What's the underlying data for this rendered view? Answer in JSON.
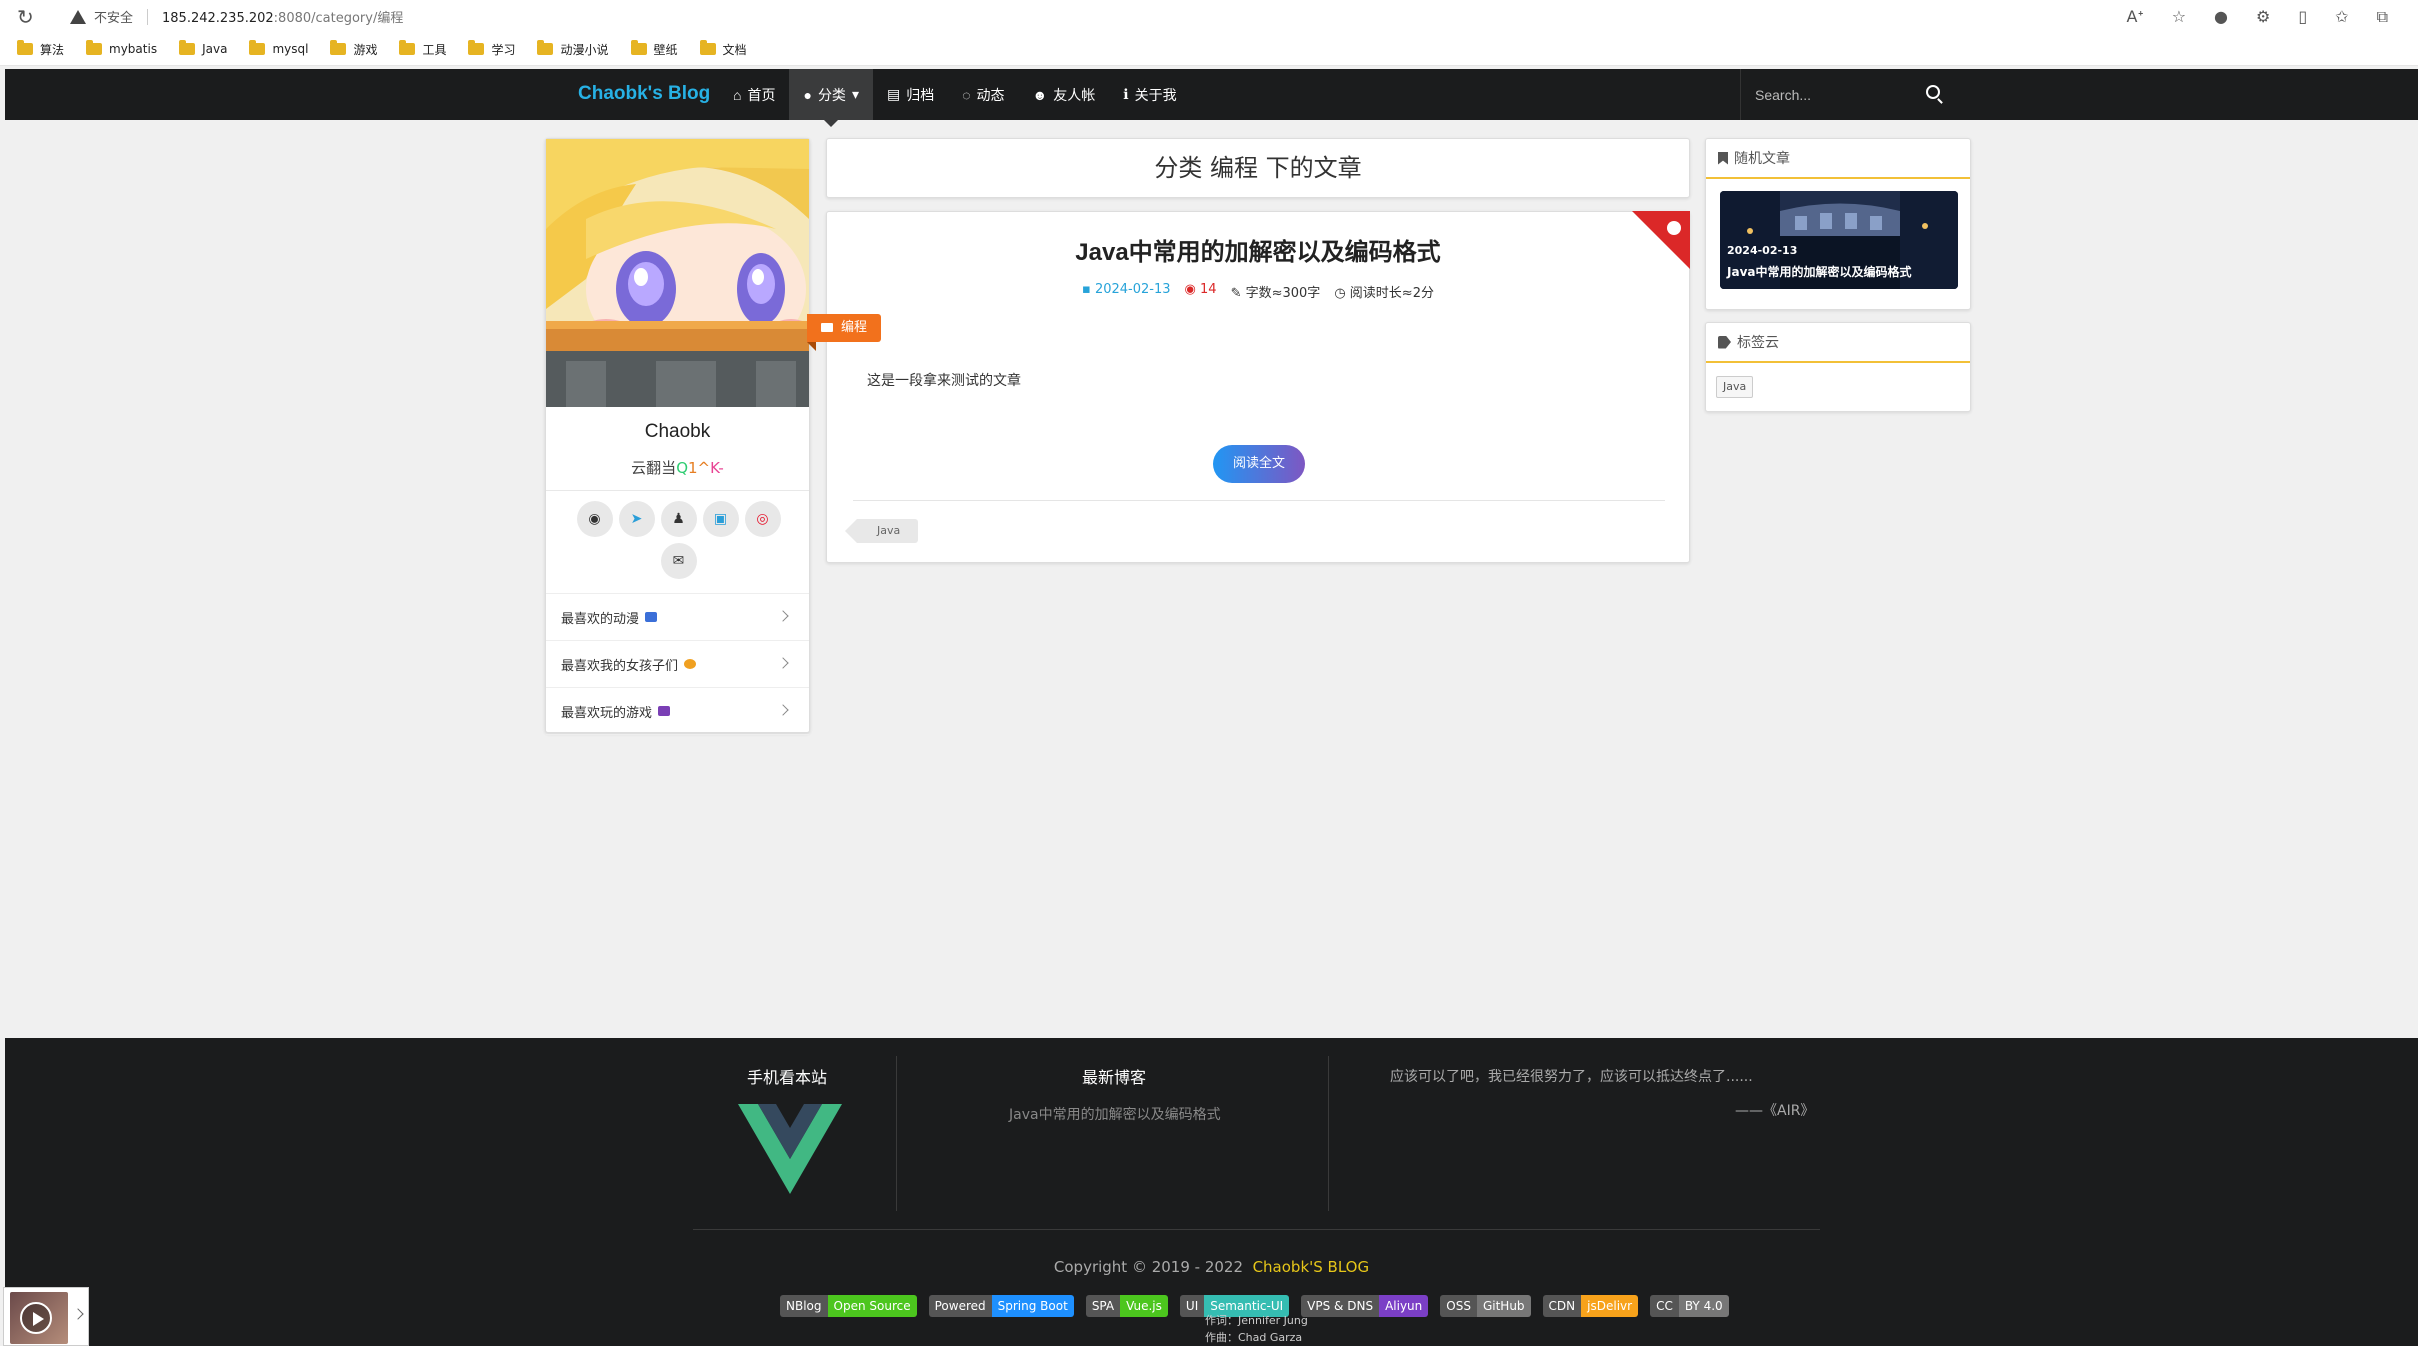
{
  "browser": {
    "security_label": "不安全",
    "url_host": "185.242.235.202",
    "url_path": ":8080/category/编程",
    "bookmarks": [
      "算法",
      "mybatis",
      "Java",
      "mysql",
      "游戏",
      "工具",
      "学习",
      "动漫小说",
      "壁纸",
      "文档"
    ]
  },
  "nav": {
    "brand": "Chaobk's Blog",
    "items": [
      {
        "label": "首页",
        "icon": "home-icon"
      },
      {
        "label": "分类",
        "icon": "lightbulb-icon",
        "active": true
      },
      {
        "label": "归档",
        "icon": "archive-icon"
      },
      {
        "label": "动态",
        "icon": "comment-icon"
      },
      {
        "label": "友人帐",
        "icon": "users-icon"
      },
      {
        "label": "关于我",
        "icon": "info-icon"
      }
    ],
    "search_placeholder": "Search..."
  },
  "profile": {
    "name": "Chaobk",
    "motto_prefix": "云翻当",
    "motto_c1": "Q",
    "motto_c2": "1^",
    "motto_c3": "K-",
    "socials": [
      "github-icon",
      "telegram-icon",
      "qq-icon",
      "bilibili-icon",
      "weibo-icon",
      "email-icon"
    ],
    "list": [
      {
        "label": "最喜欢的动漫",
        "emoji_color": "#3b6fd8"
      },
      {
        "label": "最喜欢我的女孩子们",
        "emoji_color": "#f0a020"
      },
      {
        "label": "最喜欢玩的游戏",
        "emoji_color": "#7a3fb5"
      }
    ]
  },
  "header": {
    "title": "分类 编程 下的文章"
  },
  "article": {
    "title": "Java中常用的加解密以及编码格式",
    "date": "2024-02-13",
    "views": "14",
    "words": "字数≈300字",
    "read_time": "阅读时长≈2分",
    "category": "编程",
    "excerpt": "这是一段拿来测试的文章",
    "read_more": "阅读全文",
    "tag": "Java"
  },
  "sidebar": {
    "random_title": "随机文章",
    "random_date": "2024-02-13",
    "random_post": "Java中常用的加解密以及编码格式",
    "tagcloud_title": "标签云",
    "tags": [
      "Java"
    ]
  },
  "footer": {
    "col1_title": "手机看本站",
    "col2_title": "最新博客",
    "latest_post": "Java中常用的加解密以及编码格式",
    "quote": "应该可以了吧，我已经很努力了，应该可以抵达终点了......",
    "quote_source": "——《AIR》",
    "copyright": "Copyright © 2019 - 2022",
    "copyright_brand": "Chaobk'S BLOG",
    "badges": [
      {
        "l": "NBlog",
        "r": "Open Source",
        "color": "#4cc61e"
      },
      {
        "l": "Powered",
        "r": "Spring Boot",
        "color": "#1e90ff"
      },
      {
        "l": "SPA",
        "r": "Vue.js",
        "color": "#4cc61e"
      },
      {
        "l": "UI",
        "r": "Semantic-UI",
        "color": "#35bdb2"
      },
      {
        "l": "VPS & DNS",
        "r": "Aliyun",
        "color": "#7b3fc6"
      },
      {
        "l": "OSS",
        "r": "GitHub",
        "color": "#777777"
      },
      {
        "l": "CDN",
        "r": "jsDelivr",
        "color": "#f7a21b"
      },
      {
        "l": "CC",
        "r": "BY 4.0",
        "color": "#777777"
      }
    ],
    "lyric1": "作词：Jennifer Jung",
    "lyric2": "作曲：Chad Garza"
  }
}
